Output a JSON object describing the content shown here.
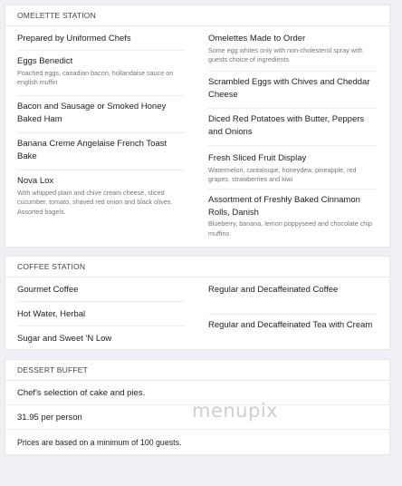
{
  "omelette": {
    "title": "OMELETTE STATION",
    "left": [
      {
        "name": "Prepared by Uniformed Chefs",
        "desc": ""
      },
      {
        "name": "Eggs Benedict",
        "desc": "Poached eggs, canadian bacon, hollandaise sauce on english muffin"
      },
      {
        "name": "Bacon and Sausage or Smoked Honey Baked Ham",
        "desc": ""
      },
      {
        "name": "Banana Creme Angelaise French Toast Bake",
        "desc": ""
      },
      {
        "name": "Nova Lox",
        "desc": "With whipped plain and chive cream cheese, sliced cucumber, tomato, shaved red onion and black olives. Assorted bagels."
      }
    ],
    "right": [
      {
        "name": "Omelettes Made to Order",
        "desc": "Some egg whites only with non-cholesterol spray with guests choice of ingredients"
      },
      {
        "name": "Scrambled Eggs with Chives and Cheddar Cheese",
        "desc": ""
      },
      {
        "name": "Diced Red Potatoes with Butter, Peppers and Onions",
        "desc": ""
      },
      {
        "name": "Fresh Sliced Fruit Display",
        "desc": "Watermelon, cantaloupe, honeydew, pineapple, red grapes, strawberries and kiwi"
      },
      {
        "name": "Assortment of Freshly Baked Cinnamon Rolls, Danish",
        "desc": "Blueberry, banana, lemon poppyseed and chocolate chip muffins"
      }
    ]
  },
  "coffee": {
    "title": "COFFEE STATION",
    "left": [
      {
        "name": "Gourmet Coffee"
      },
      {
        "name": "Hot Water, Herbal"
      },
      {
        "name": "Sugar and Sweet 'N Low"
      }
    ],
    "right": [
      {
        "name": "Regular and Decaffeinated Coffee"
      },
      {
        "name": "Regular and Decaffeinated Tea with Cream"
      }
    ]
  },
  "dessert": {
    "title": "DESSERT BUFFET",
    "rows": [
      "Chef's selection of cake and pies.",
      "31.95 per person",
      "Prices are based on a minimum of 100 guests."
    ]
  },
  "watermark": "menupix"
}
